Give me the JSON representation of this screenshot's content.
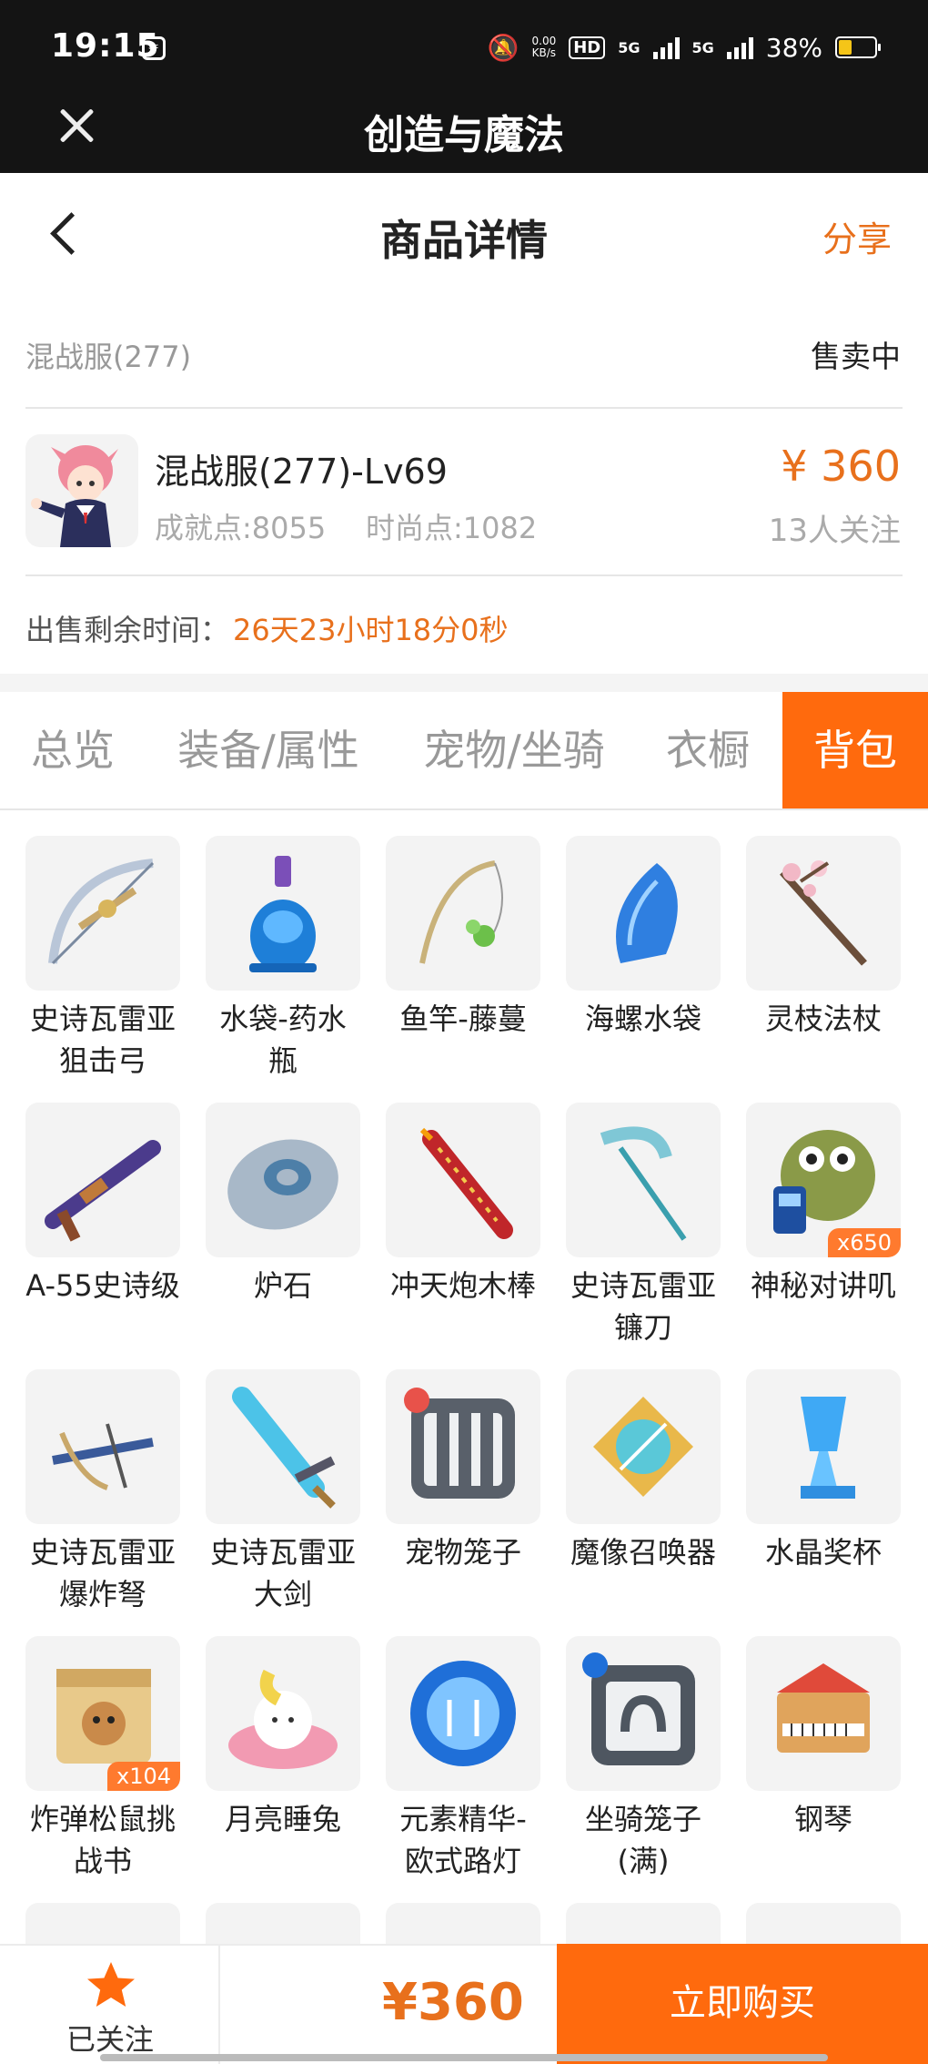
{
  "status_bar": {
    "time": "19:15",
    "net_speed_value": "0.00",
    "net_speed_unit": "KB/s",
    "hd_label": "HD",
    "network1": "5G",
    "network2": "5G",
    "battery": "38%",
    "battery_level": 0.38
  },
  "app_bar": {
    "title": "创造与魔法"
  },
  "header": {
    "title": "商品详情",
    "share": "分享"
  },
  "info": {
    "server": "混战服(277)",
    "status": "售卖中",
    "name": "混战服(277)-Lv69",
    "achievement": "成就点:8055",
    "fashion": "时尚点:1082",
    "price": "¥ 360",
    "followers": "13人关注",
    "remain_label": "出售剩余时间：",
    "remain_value": "26天23小时18分0秒"
  },
  "tabs": [
    {
      "label": "总览"
    },
    {
      "label": "装备/属性"
    },
    {
      "label": "宠物/坐骑"
    },
    {
      "label": "衣橱"
    },
    {
      "label": "背包"
    }
  ],
  "active_tab": "背包",
  "items": [
    {
      "name": "史诗瓦雷亚\n狙击弓",
      "icon": "bow-icon"
    },
    {
      "name": "水袋-药水\n瓶",
      "icon": "potion-bottle-icon"
    },
    {
      "name": "鱼竿-藤蔓",
      "icon": "fishing-rod-icon"
    },
    {
      "name": "海螺水袋",
      "icon": "conch-icon"
    },
    {
      "name": "灵枝法杖",
      "icon": "branch-staff-icon"
    },
    {
      "name": "A-55史诗级",
      "icon": "rifle-icon"
    },
    {
      "name": "炉石",
      "icon": "hearthstone-icon"
    },
    {
      "name": "冲天炮木棒",
      "icon": "firework-icon"
    },
    {
      "name": "史诗瓦雷亚\n镰刀",
      "icon": "scythe-icon"
    },
    {
      "name": "神秘对讲叽",
      "icon": "walkie-talkie-icon",
      "qty": "x650"
    },
    {
      "name": "史诗瓦雷亚\n爆炸弩",
      "icon": "crossbow-icon"
    },
    {
      "name": "史诗瓦雷亚\n大剑",
      "icon": "greatsword-icon"
    },
    {
      "name": "宠物笼子",
      "icon": "pet-cage-icon"
    },
    {
      "name": "魔像召唤器",
      "icon": "golem-summoner-icon"
    },
    {
      "name": "水晶奖杯",
      "icon": "crystal-trophy-icon"
    },
    {
      "name": "炸弹松鼠挑\n战书",
      "icon": "wanted-scroll-icon",
      "qty": "x104"
    },
    {
      "name": "月亮睡兔",
      "icon": "moon-rabbit-icon"
    },
    {
      "name": "元素精华-\n欧式路灯",
      "icon": "element-orb-icon"
    },
    {
      "name": "坐骑笼子\n(满)",
      "icon": "mount-cage-icon"
    },
    {
      "name": "钢琴",
      "icon": "piano-icon"
    }
  ],
  "bottom": {
    "follow_label": "已关注",
    "price": "¥360",
    "buy_label": "立即购买"
  },
  "colors": {
    "accent": "#ff6a0d",
    "price": "#e8701c",
    "dark_bar": "#141414"
  }
}
